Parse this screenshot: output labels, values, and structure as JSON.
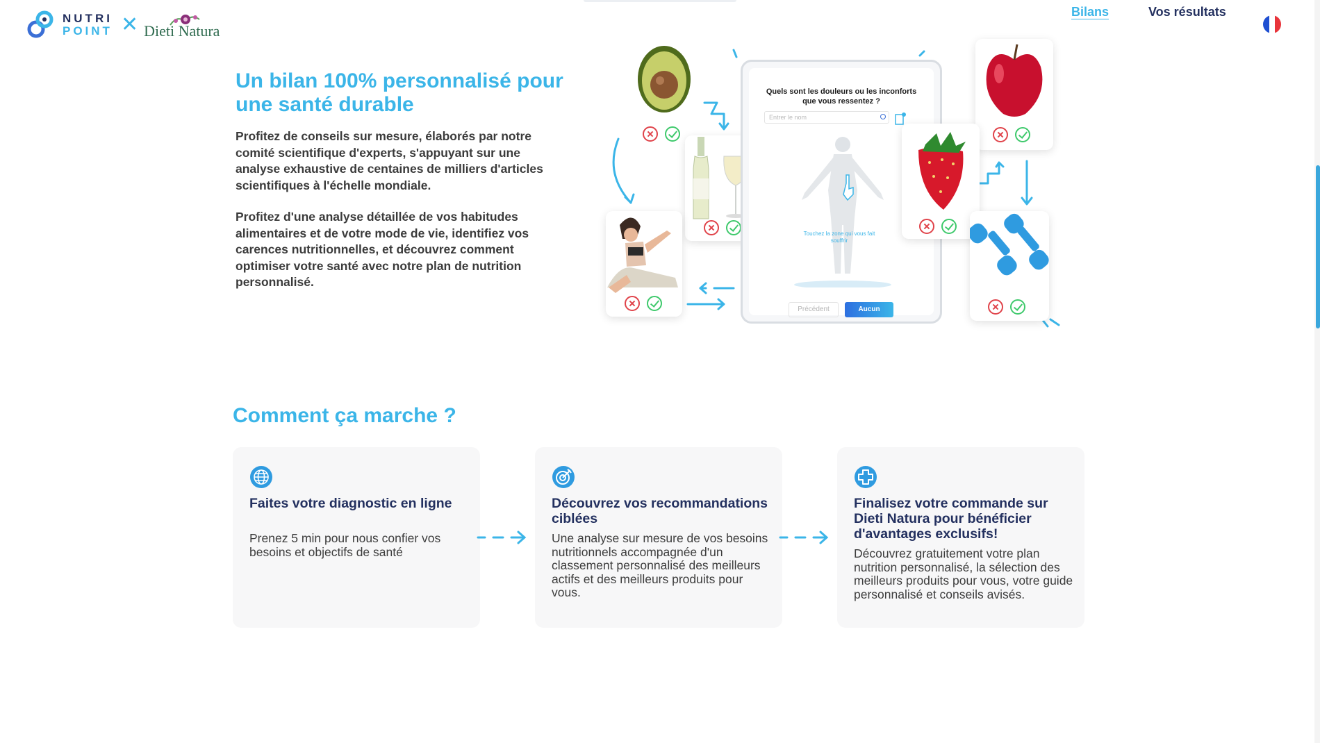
{
  "header": {
    "logo_nutri": "NUTRI",
    "logo_point": "POINT",
    "logo_separator": "✕",
    "logo_partner": "Dieti Natura",
    "nav": {
      "bilans": "Bilans",
      "results": "Vos résultats"
    },
    "language_flag": "fr"
  },
  "hero": {
    "title": "Un bilan 100% personnalisé pour une santé durable",
    "paragraph1": "Profitez de conseils sur mesure, élaborés par notre comité scientifique d'experts, s'appuyant sur une analyse exhaustive de centaines de milliers d'articles scientifiques à l'échelle mondiale.",
    "paragraph2": "Profitez d'une analyse détaillée de vos habitudes alimentaires et de votre mode de vie, identifiez vos carences nutritionnelles, et découvrez comment optimiser votre santé avec notre plan de nutrition personnalisé."
  },
  "illustration": {
    "question": "Quels sont les douleurs ou les inconforts que vous ressentez ?",
    "search_placeholder": "Entrer le nom",
    "hint": "Touchez la zone qui vous fait souffrir",
    "prev_button": "Précédent",
    "next_button": "Aucun",
    "items": [
      "avocado",
      "wine",
      "yoga",
      "apple",
      "strawberry",
      "dumbbells"
    ]
  },
  "how": {
    "title": "Comment ça marche ?",
    "steps": [
      {
        "icon": "globe-icon",
        "title": "Faites votre diagnostic en ligne",
        "text": "Prenez 5 min pour nous confier vos besoins et objectifs de santé"
      },
      {
        "icon": "target-icon",
        "title": "Découvrez vos recommandations ciblées",
        "text": "Une analyse sur mesure de vos besoins nutritionnels accompagnée d'un classement personnalisé des meilleurs actifs et des meilleurs produits pour vous."
      },
      {
        "icon": "plus-circle-icon",
        "title": "Finalisez votre commande sur Dieti Natura pour bénéficier d'avantages exclusifs!",
        "text": "Découvrez gratuitement votre plan nutrition personnalisé, la sélection des meilleurs produits pour vous, votre guide personnalisé et conseils avisés."
      }
    ]
  },
  "colors": {
    "accent": "#3bb5e8",
    "navy": "#23305f",
    "reject": "#e0434a",
    "accept": "#3ec96b"
  }
}
